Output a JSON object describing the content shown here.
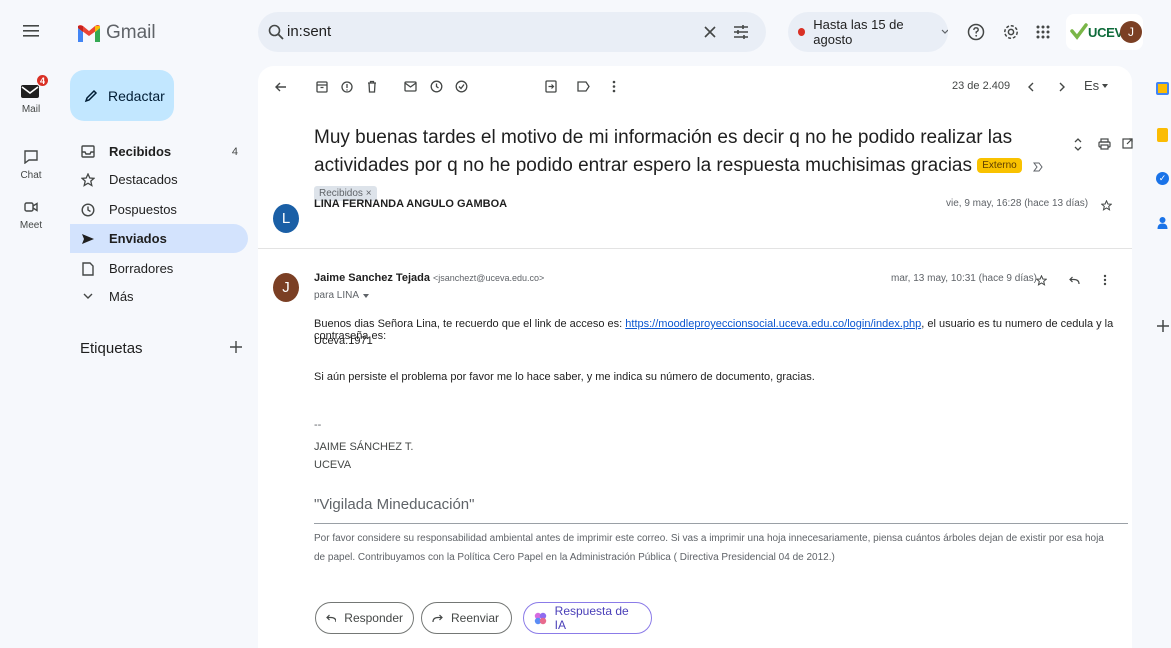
{
  "rail": {
    "mail_label": "Mail",
    "mail_badge": "4",
    "chat_label": "Chat",
    "meet_label": "Meet"
  },
  "logo": {
    "text": "Gmail"
  },
  "search": {
    "query": "in:sent"
  },
  "vacation_chip": {
    "label": "Hasta las 15 de agosto"
  },
  "account": {
    "avatar_letter": "J",
    "org_logo_text": "UCEVA"
  },
  "sidebar": {
    "compose_label": "Redactar",
    "items": [
      {
        "label": "Recibidos",
        "count": "4"
      },
      {
        "label": "Destacados",
        "count": ""
      },
      {
        "label": "Pospuestos",
        "count": ""
      },
      {
        "label": "Enviados",
        "count": ""
      },
      {
        "label": "Borradores",
        "count": ""
      },
      {
        "label": "Más",
        "count": ""
      }
    ],
    "labels_heading": "Etiquetas"
  },
  "toolbar": {
    "pagination": "23 de 2.409",
    "language": "Es"
  },
  "thread": {
    "subject": "Muy buenas tardes el motivo de mi información es decir q no he podido realizar las actividades por q no he podido entrar espero la respuesta muchisimas gracias",
    "tag_external": "Externo",
    "tag_inbox": "Recibidos",
    "message1": {
      "avatar_letter": "L",
      "sender": "LINA FERNANDA ANGULO GAMBOA",
      "date": "vie, 9 may, 16:28 (hace 13 días)"
    },
    "message2": {
      "avatar_letter": "J",
      "sender_name": "Jaime Sanchez Tejada",
      "sender_email": "<jsanchezt@uceva.edu.co>",
      "recipient": "para LINA",
      "date": "mar, 13 may, 10:31 (hace 9 días)",
      "body_intro": "Buenos dias Señora Lina, te recuerdo que el link de acceso es: ",
      "body_link": "https://moodleproyeccionsocial.uceva.edu.co/login/index.php",
      "body_after_link": ", el usuario es tu numero de cedula y la contraseña es:",
      "body_password": "Uceva.1971",
      "body_p2": "Si aún persiste el problema por favor me lo hace saber, y me indica su número de documento, gracias.",
      "sig_dashes": "--",
      "sig_name": "JAIME SÁNCHEZ T.",
      "sig_org": "UCEVA",
      "sig_motto": "\"Vigilada Mineducación\"",
      "footer_line1": "Por favor considere su responsabilidad ambiental antes de imprimir este correo.  Si vas a imprimir una hoja innecesariamente, piensa cuántos árboles dejan de existir por esa hoja",
      "footer_line2": "de papel.  Contribuyamos con la Política Cero Papel en la Administración Pública ( Directiva Presidencial 04 de 2012.)"
    }
  },
  "actions": {
    "reply": "Responder",
    "forward": "Reenviar",
    "ai_reply": "Respuesta de IA"
  },
  "colors": {
    "accent": "#0b57d0",
    "compose_bg": "#c2e7ff",
    "active_nav": "#d3e3fd",
    "badge_red": "#d93025",
    "avatar_lina": "#1a5fa6",
    "avatar_jaime": "#7b3f24"
  }
}
